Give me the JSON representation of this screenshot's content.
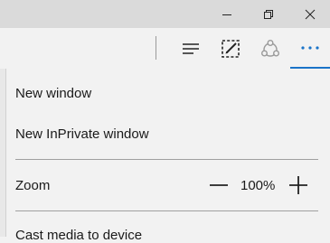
{
  "window": {
    "minimize_icon": "minimize-icon",
    "restore_icon": "restore-icon",
    "close_icon": "close-icon"
  },
  "toolbar": {
    "hub_icon": "hub-icon",
    "web_note_icon": "web-note-icon",
    "share_icon": "share-icon",
    "more_icon": "more-icon",
    "more_label": "···",
    "accent_color": "#1a73c8"
  },
  "menu": {
    "new_window": "New window",
    "new_inprivate_window": "New InPrivate window",
    "zoom_label": "Zoom",
    "zoom_value": "100%",
    "cast_media": "Cast media to device"
  }
}
